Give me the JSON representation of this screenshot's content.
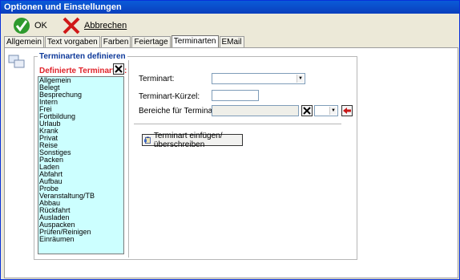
{
  "window": {
    "title": "Optionen und Einstellungen"
  },
  "toolbar": {
    "ok_label": "OK",
    "cancel_label": "Abbrechen"
  },
  "tabs": [
    {
      "label": "Allgemein"
    },
    {
      "label": "Text vorgaben"
    },
    {
      "label": "Farben"
    },
    {
      "label": "Feiertage"
    },
    {
      "label": "Terminarten"
    },
    {
      "label": "EMail"
    }
  ],
  "active_tab": "Terminarten",
  "group": {
    "title": "Terminarten definieren",
    "list_label": "Definierte Terminarten:",
    "items": [
      "Allgemein",
      "Belegt",
      "Besprechung",
      "Intern",
      "Frei",
      "Fortbildung",
      "Urlaub",
      "Krank",
      "Privat",
      "Reise",
      "Sonstiges",
      "Packen",
      "Laden",
      "Abfahrt",
      "Aufbau",
      "Probe",
      "Veranstaltung/TB",
      "Abbau",
      "Rückfahrt",
      "Ausladen",
      "Auspacken",
      "Prüfen/Reinigen",
      "Einräumen"
    ]
  },
  "form": {
    "terminart_label": "Terminart:",
    "terminart_value": "",
    "kuerzel_label": "Terminart-Kürzel:",
    "kuerzel_value": "",
    "bereiche_label": "Bereiche für Terminart:",
    "bereiche_value": "",
    "bereiche_select_value": "",
    "insert_button_label": "Terminart einfügen/überschreiben"
  },
  "colors": {
    "title_accent": "#0f3a9a",
    "list_label_red": "#e0232b",
    "list_bg": "#ccffff"
  },
  "icons": {
    "ok": "checkmark-icon",
    "cancel": "red-x-icon",
    "delete": "delete-x-icon",
    "arrow": "red-arrow-left-icon",
    "clipboard": "clipboard-icon"
  }
}
